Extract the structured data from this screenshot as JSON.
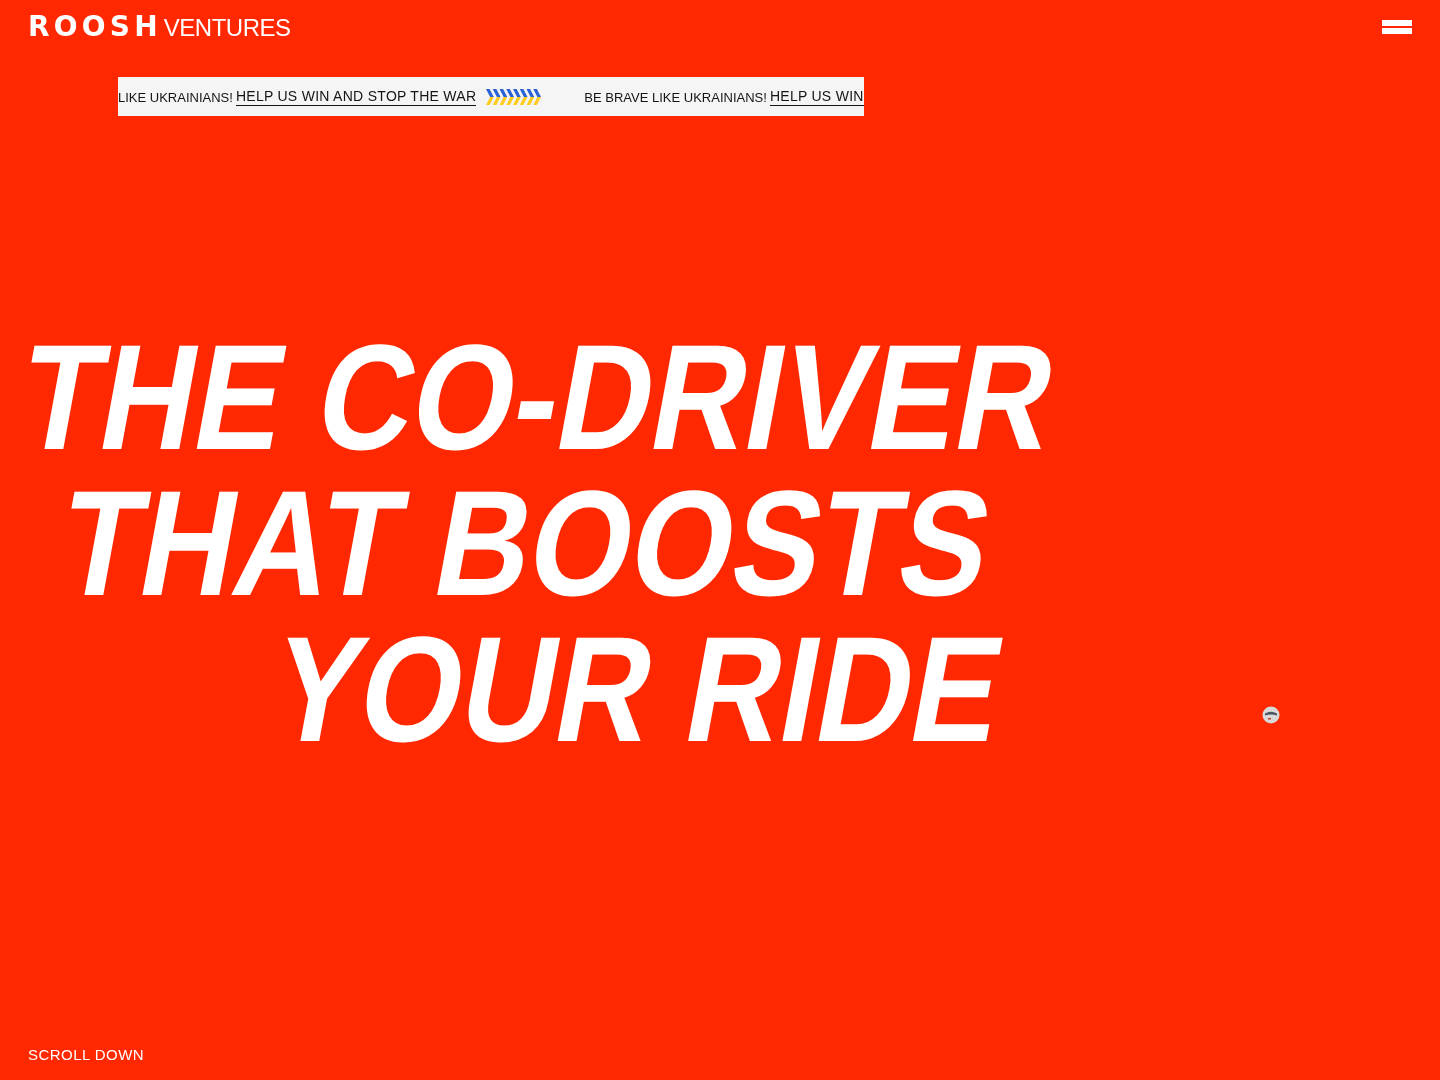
{
  "header": {
    "logo": {
      "mark": "ROOSH",
      "text": "VENTURES"
    }
  },
  "ticker": [
    {
      "slogan": "LIKE UKRAINIANS!",
      "link": "HELP US WIN AND STOP THE WAR"
    },
    {
      "slogan": "BE BRAVE LIKE UKRAINIANS!",
      "link": "HELP US WIN"
    }
  ],
  "hero": {
    "lines": [
      "THE CO-DRIVER",
      "THAT BOOSTS",
      "YOUR RIDE"
    ]
  },
  "scroll_hint": "SCROLL DOWN"
}
